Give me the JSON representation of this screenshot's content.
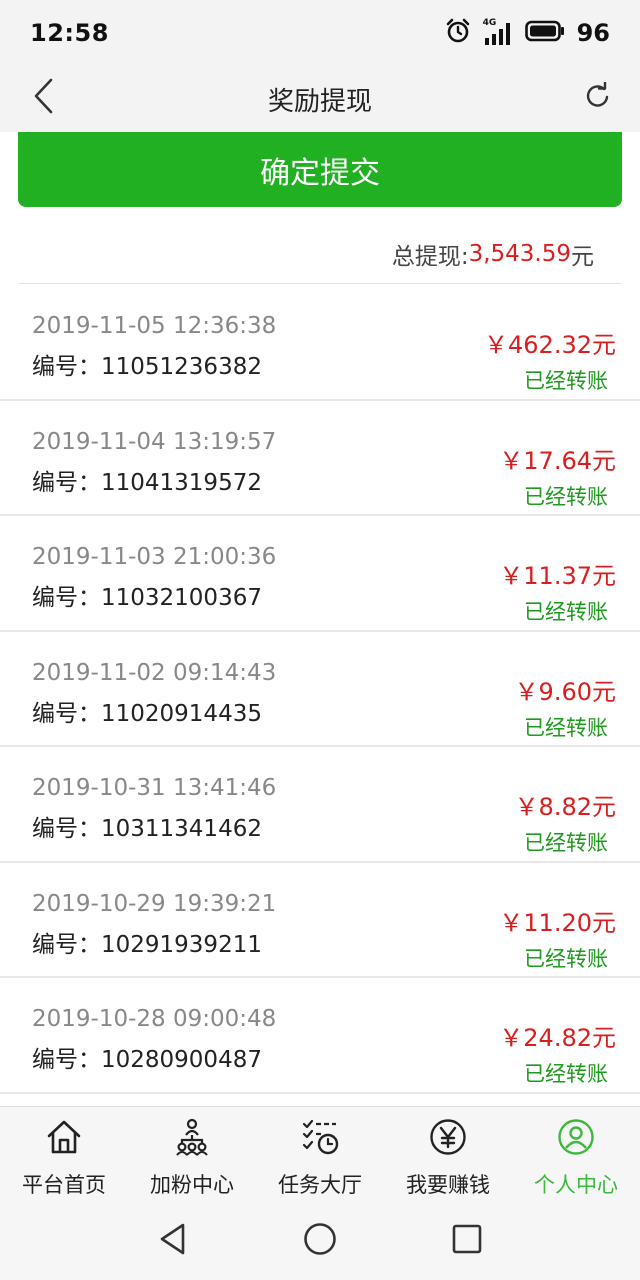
{
  "status_bar": {
    "time": "12:58",
    "network": "4G",
    "battery": "96",
    "icons": [
      "alarm-icon",
      "signal-icon",
      "battery-icon"
    ]
  },
  "header": {
    "title": "奖励提现",
    "back_icon": "chevron-left-icon",
    "refresh_icon": "refresh-icon"
  },
  "submit_button": {
    "label": "确定提交"
  },
  "total": {
    "label": "总提现: ",
    "amount": "3,543.59",
    "unit": "元"
  },
  "records": [
    {
      "time": "2019-11-05 12:36:38",
      "id": "编号：11051236382",
      "amount": "￥462.32元",
      "status": "已经转账"
    },
    {
      "time": "2019-11-04 13:19:57",
      "id": "编号：11041319572",
      "amount": "￥17.64元",
      "status": "已经转账"
    },
    {
      "time": "2019-11-03 21:00:36",
      "id": "编号：11032100367",
      "amount": "￥11.37元",
      "status": "已经转账"
    },
    {
      "time": "2019-11-02 09:14:43",
      "id": "编号：11020914435",
      "amount": "￥9.60元",
      "status": "已经转账"
    },
    {
      "time": "2019-10-31 13:41:46",
      "id": "编号：10311341462",
      "amount": "￥8.82元",
      "status": "已经转账"
    },
    {
      "time": "2019-10-29 19:39:21",
      "id": "编号：10291939211",
      "amount": "￥11.20元",
      "status": "已经转账"
    },
    {
      "time": "2019-10-28 09:00:48",
      "id": "编号：10280900487",
      "amount": "￥24.82元",
      "status": "已经转账"
    }
  ],
  "tabs": [
    {
      "label": "平台首页",
      "icon": "home-icon",
      "active": false
    },
    {
      "label": "加粉中心",
      "icon": "users-network-icon",
      "active": false
    },
    {
      "label": "任务大厅",
      "icon": "task-list-icon",
      "active": false
    },
    {
      "label": "我要赚钱",
      "icon": "yuan-coin-icon",
      "active": false
    },
    {
      "label": "个人中心",
      "icon": "user-profile-icon",
      "active": true
    }
  ],
  "colors": {
    "primary_green": "#21b021",
    "amount_red": "#d81e1e",
    "status_green": "#1e9a1e",
    "active_tab": "#3cb83c"
  },
  "nav_bar": {
    "icons": [
      "nav-back-icon",
      "nav-home-icon",
      "nav-recents-icon"
    ]
  }
}
